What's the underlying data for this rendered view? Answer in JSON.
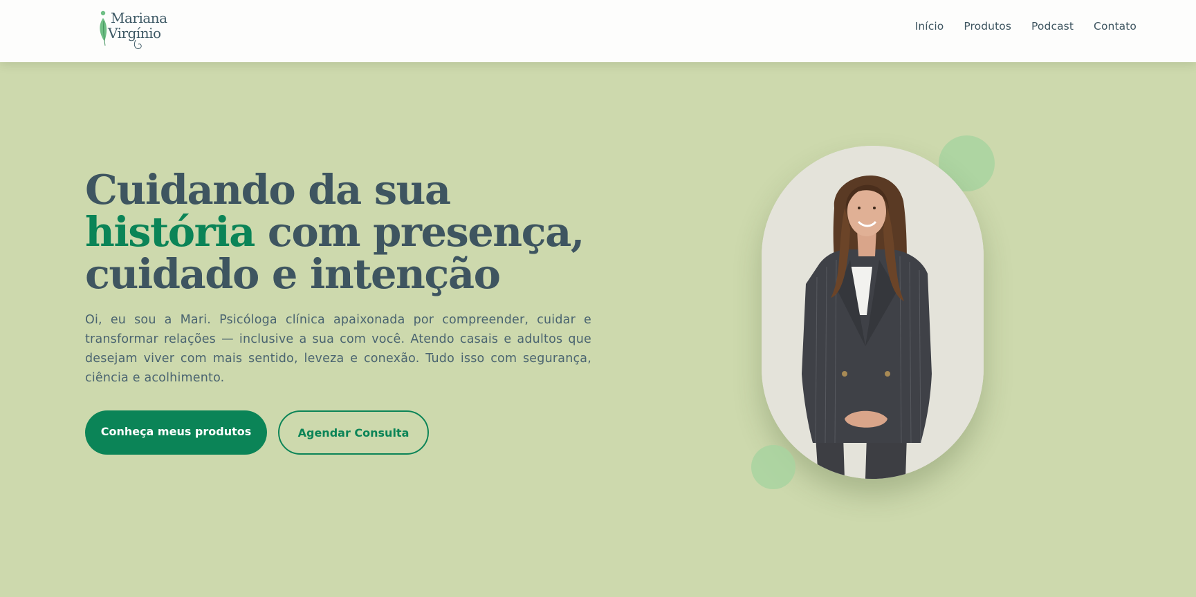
{
  "header": {
    "logo": {
      "line1": "Mariana",
      "line2": "Virgínio",
      "icon": "leaf-icon"
    },
    "nav": [
      {
        "label": "Início"
      },
      {
        "label": "Produtos"
      },
      {
        "label": "Podcast"
      },
      {
        "label": "Contato"
      }
    ]
  },
  "hero": {
    "title_part1": "Cuidando da sua ",
    "title_accent": "história",
    "title_part2": " com presença, cuidado e intenção",
    "description": "Oi, eu sou a Mari. Psicóloga clínica apaixonada por compreender, cuidar e transformar relações — inclusive a sua com você. Atendo casais e adultos que desejam viver com mais sentido, leveza e conexão. Tudo isso com segurança, ciência e acolhimento.",
    "primary_button": "Conheça meus produtos",
    "secondary_button": "Agendar Consulta"
  },
  "colors": {
    "background": "#cdd9ad",
    "accent": "#0b8457",
    "text": "#3e5560",
    "header": "#fdfdfc",
    "decor_circle": "#a8d3a0"
  }
}
